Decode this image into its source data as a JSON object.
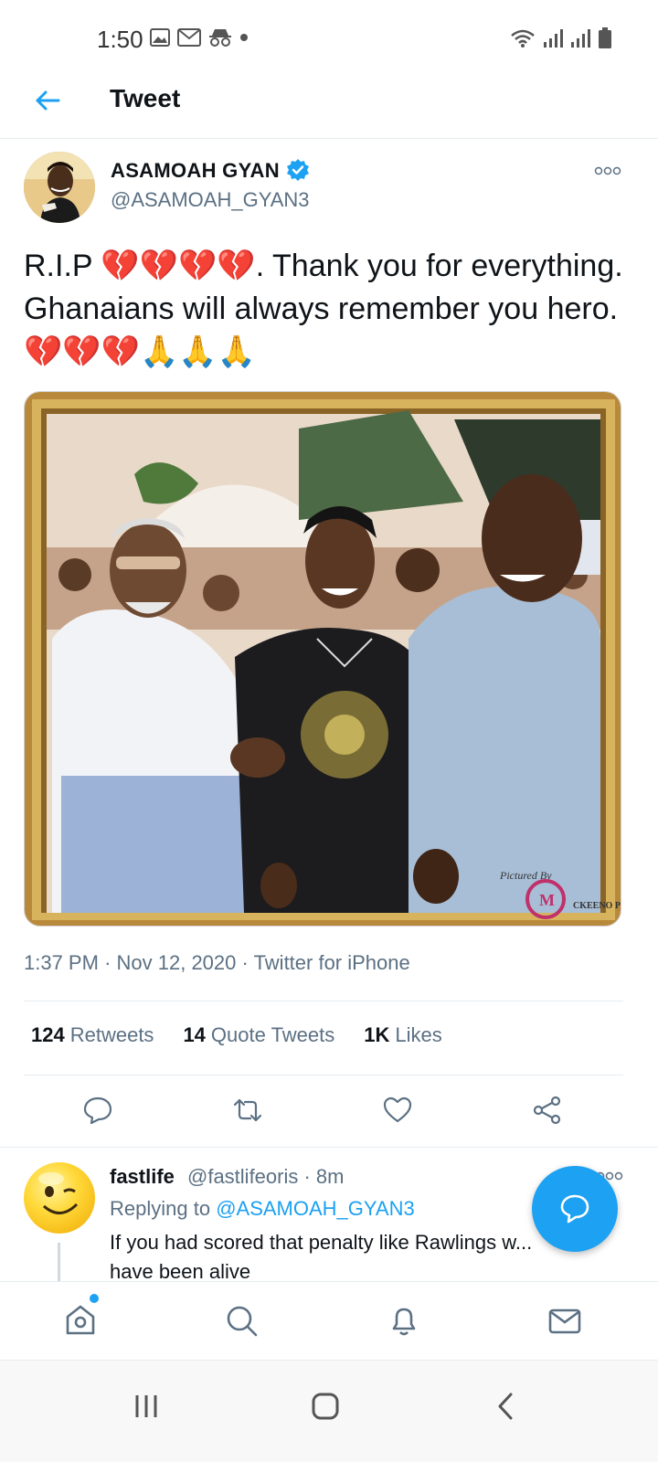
{
  "status_bar": {
    "time": "1:50",
    "left_icons": [
      "image-icon",
      "gmail-icon",
      "incognito-icon",
      "dot-icon"
    ],
    "right_icons": [
      "wifi-icon",
      "signal-icon",
      "signal-icon",
      "battery-icon"
    ]
  },
  "header": {
    "title": "Tweet"
  },
  "tweet": {
    "author_name": "ASAMOAH GYAN",
    "author_handle": "@ASAMOAH_GYAN3",
    "text_part1": "R.I.P ",
    "emoji_hearts_1": "💔💔💔💔",
    "text_part2": ". Thank you for everything. Ghanaians will always remember you hero. ",
    "emoji_hearts_2": "💔💔💔",
    "emoji_pray": "🙏🙏🙏",
    "time": "1:37 PM",
    "date": "Nov 12, 2020",
    "source": "Twitter for iPhone",
    "image_watermark": "Pictured By",
    "image_watermark_name": "CKEENO P",
    "stats": {
      "retweets_count": "124",
      "retweets_label": "Retweets",
      "quotes_count": "14",
      "quotes_label": "Quote Tweets",
      "likes_count": "1K",
      "likes_label": "Likes"
    }
  },
  "reply": {
    "name": "fastlife",
    "handle_time": "@fastlifeoris · 8m",
    "replying_prefix": "Replying to ",
    "replying_to": "@ASAMOAH_GYAN3",
    "text": "If you had scored that penalty like Rawlings w... have been alive"
  },
  "colors": {
    "accent": "#1da1f2",
    "text_primary": "#0f1419",
    "text_secondary": "#5b7083",
    "heart": "#e0245e"
  }
}
